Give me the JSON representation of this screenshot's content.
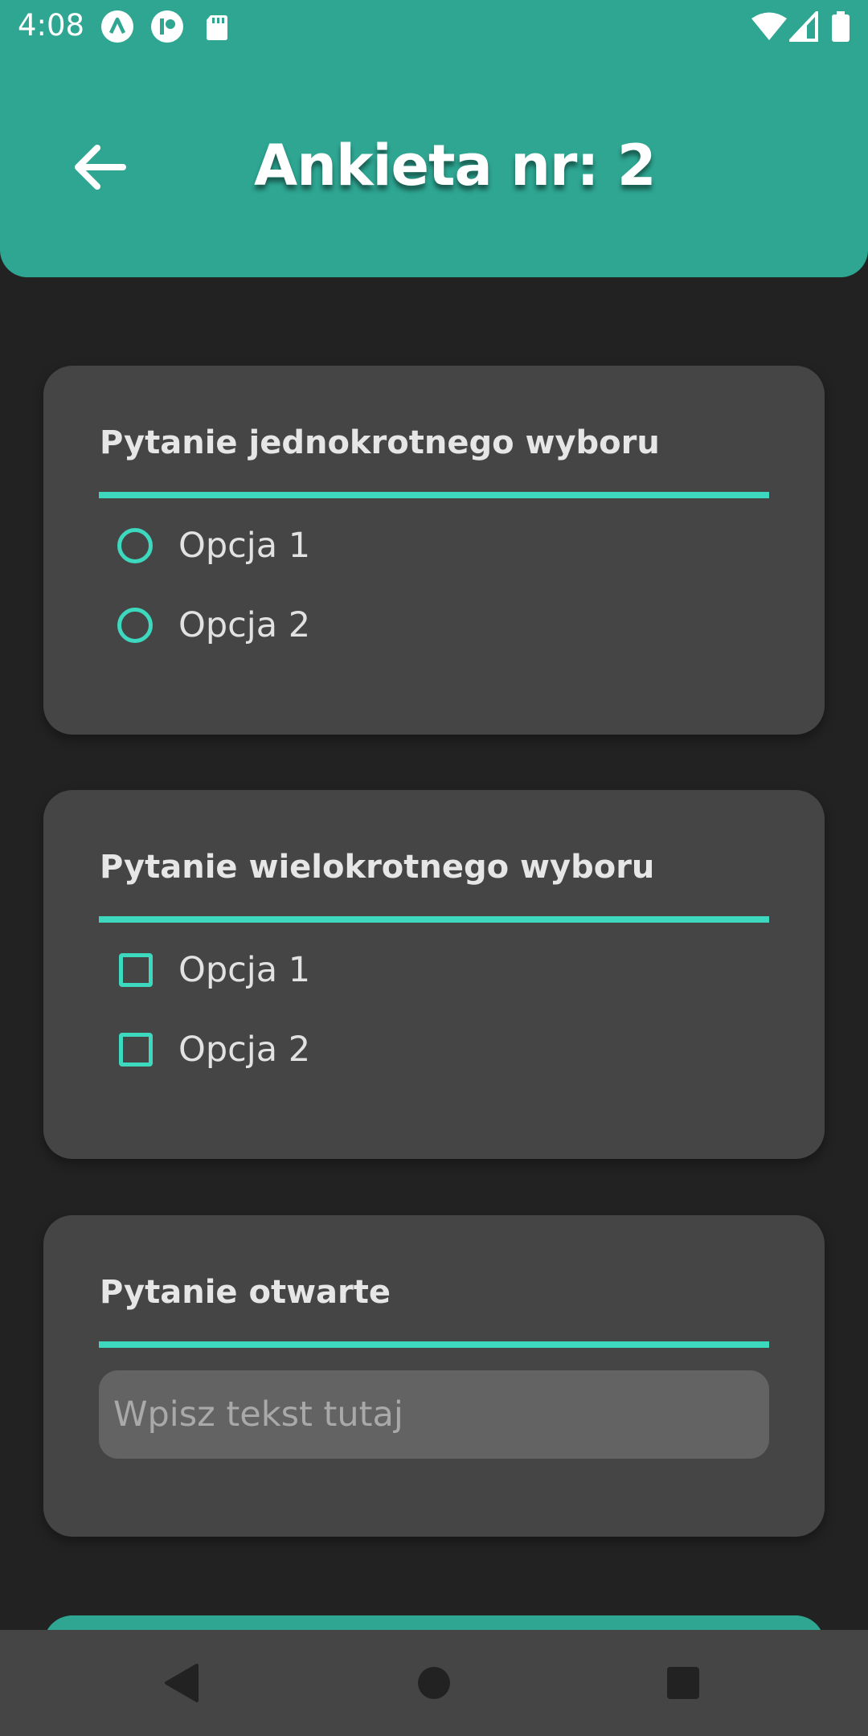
{
  "status_bar": {
    "time": "4:08",
    "notification_icons": [
      "a-app-icon",
      "p-app-icon",
      "sd-card-icon"
    ],
    "system_icons": [
      "wifi-icon",
      "signal-icon",
      "battery-icon"
    ]
  },
  "header": {
    "title": "Ankieta nr: 2",
    "back_icon": "arrow-left-icon",
    "background_color": "#2ea692"
  },
  "questions": [
    {
      "type": "single_choice",
      "title": "Pytanie jednokrotnego wyboru",
      "options": [
        {
          "label": "Opcja 1",
          "selected": false
        },
        {
          "label": "Opcja 2",
          "selected": false
        }
      ]
    },
    {
      "type": "multiple_choice",
      "title": "Pytanie wielokrotnego wyboru",
      "options": [
        {
          "label": "Opcja 1",
          "checked": false
        },
        {
          "label": "Opcja 2",
          "checked": false
        }
      ]
    },
    {
      "type": "open",
      "title": "Pytanie otwarte",
      "input": {
        "value": "",
        "placeholder": "Wpisz tekst tutaj"
      }
    }
  ],
  "nav_bar": {
    "buttons": [
      "back-triangle-icon",
      "home-circle-icon",
      "recents-square-icon"
    ]
  },
  "colors": {
    "accent": "#3dd9be",
    "primary": "#2ea692",
    "background": "#222222",
    "card": "#454545",
    "input": "#636363"
  }
}
